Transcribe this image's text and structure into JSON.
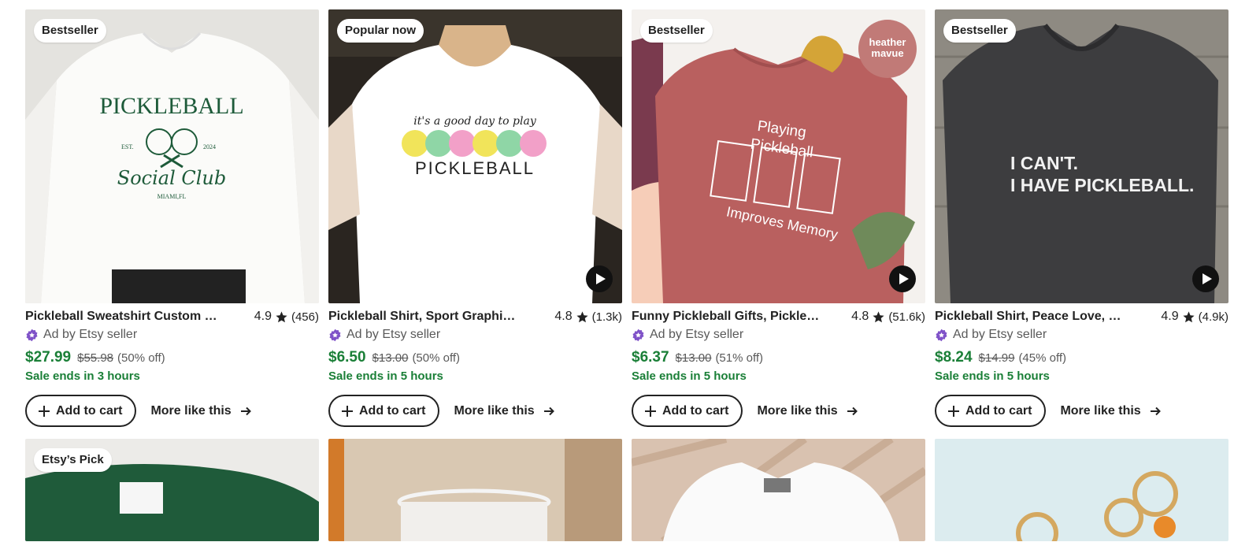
{
  "colors": {
    "sale_green": "#1a7f37",
    "text": "#222222",
    "muted": "#595959",
    "seller_purple": "#7f52c8"
  },
  "icons": {
    "star": "star-icon",
    "play": "play-icon",
    "plus": "plus-icon",
    "arrow": "arrow-right-icon",
    "seller": "etsy-seller-badge-icon"
  },
  "products": [
    {
      "badge": "Bestseller",
      "title": "Pickleball Sweatshirt Custom Pickleball Social Club Sweatshirt",
      "rating": "4.9",
      "reviews": "(456)",
      "seller": "Ad by Etsy seller",
      "price": "$27.99",
      "original": "$55.98",
      "discount": "(50% off)",
      "sale": "Sale ends in 3 hours",
      "add_label": "Add to cart",
      "more_label": "More like this",
      "has_video": false,
      "art_text": [
        "PICKLEBALL",
        "EST.",
        "2024",
        "Social Club",
        "MIAMI,FL"
      ]
    },
    {
      "badge": "Popular now",
      "title": "Pickleball Shirt, Sport Graphic Tee",
      "rating": "4.8",
      "reviews": "(1.3k)",
      "seller": "Ad by Etsy seller",
      "price": "$6.50",
      "original": "$13.00",
      "discount": "(50% off)",
      "sale": "Sale ends in 5 hours",
      "add_label": "Add to cart",
      "more_label": "More like this",
      "has_video": true,
      "art_text": [
        "it's a good day to play",
        "PICKLEBALL"
      ]
    },
    {
      "badge": "Bestseller",
      "title": "Funny Pickleball Gifts, Pickleball Shirt",
      "rating": "4.8",
      "reviews": "(51.6k)",
      "seller": "Ad by Etsy seller",
      "price": "$6.37",
      "original": "$13.00",
      "discount": "(51% off)",
      "sale": "Sale ends in 5 hours",
      "add_label": "Add to cart",
      "more_label": "More like this",
      "has_video": true,
      "art_text": [
        "Playing",
        "Pickleball",
        "Improves Memory",
        "heather",
        "mavue"
      ]
    },
    {
      "badge": "Bestseller",
      "title": "Pickleball Shirt, Peace Love, Funny Shirt",
      "rating": "4.9",
      "reviews": "(4.9k)",
      "seller": "Ad by Etsy seller",
      "price": "$8.24",
      "original": "$14.99",
      "discount": "(45% off)",
      "sale": "Sale ends in 5 hours",
      "add_label": "Add to cart",
      "more_label": "More like this",
      "has_video": true,
      "art_text": [
        "I CAN'T.",
        "I HAVE PICKLEBALL."
      ]
    }
  ],
  "row2": [
    {
      "badge": "Etsy’s Pick"
    },
    {
      "badge": ""
    },
    {
      "badge": ""
    },
    {
      "badge": ""
    }
  ]
}
